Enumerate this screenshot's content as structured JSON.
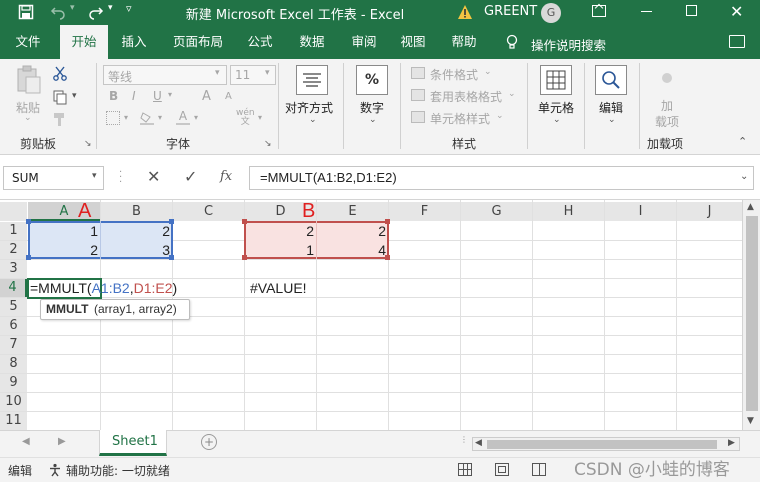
{
  "title_bar": {
    "title": "新建 Microsoft Excel 工作表  -  Excel",
    "user_name": "GREENT",
    "avatar_letter": "G",
    "window_controls": [
      "minimize",
      "maximize",
      "close"
    ]
  },
  "tabs": [
    {
      "label": "文件",
      "active": false
    },
    {
      "label": "开始",
      "active": true
    },
    {
      "label": "插入",
      "active": false
    },
    {
      "label": "页面布局",
      "active": false
    },
    {
      "label": "公式",
      "active": false
    },
    {
      "label": "数据",
      "active": false
    },
    {
      "label": "审阅",
      "active": false
    },
    {
      "label": "视图",
      "active": false
    },
    {
      "label": "帮助",
      "active": false
    }
  ],
  "tell_me": "操作说明搜索",
  "ribbon": {
    "clipboard": {
      "paste_label": "粘贴",
      "group_label": "剪贴板"
    },
    "font": {
      "font_name": "等线",
      "font_size": "11",
      "group_label": "字体",
      "bold": "B",
      "italic": "I",
      "underline": "U",
      "grow": "A",
      "shrink": "A"
    },
    "alignment": {
      "label": "对齐方式"
    },
    "number": {
      "label": "数字",
      "symbol": "%"
    },
    "styles": {
      "items": [
        "条件格式",
        "套用表格格式",
        "单元格样式"
      ],
      "group_label": "样式"
    },
    "cells": {
      "label": "单元格"
    },
    "editing": {
      "label": "编辑"
    },
    "addins": {
      "label_line1": "加",
      "label_line2": "载项",
      "group_label": "加载项"
    }
  },
  "formula_bar": {
    "name_box": "SUM",
    "fx": "fx",
    "formula": "=MMULT(A1:B2,D1:E2)"
  },
  "grid": {
    "columns": [
      "A",
      "B",
      "C",
      "D",
      "E",
      "F",
      "G",
      "H",
      "I",
      "J"
    ],
    "rows": [
      "1",
      "2",
      "3",
      "4",
      "5",
      "6",
      "7",
      "8",
      "9",
      "10",
      "11"
    ],
    "cells": {
      "A1": "1",
      "B1": "2",
      "D1": "2",
      "E1": "2",
      "A2": "2",
      "B2": "3",
      "D2": "1",
      "E2": "4",
      "D4": "#VALUE!"
    },
    "edit_formula": {
      "prefix": "=MMULT(",
      "range1": "A1:B2",
      "comma": ",",
      "range2": "D1:E2",
      "suffix": ")"
    },
    "tooltip": {
      "fn": "MMULT",
      "args": "(array1, array2)"
    },
    "annotation_a": "A",
    "annotation_b": "B",
    "range1_color": "#4472c4",
    "range2_color": "#c0504d"
  },
  "sheet_tabs": [
    {
      "label": "Sheet1",
      "active": true
    }
  ],
  "status": {
    "mode": "编辑",
    "accessibility": "辅助功能: 一切就绪"
  },
  "watermark": "CSDN @小蛙的博客"
}
